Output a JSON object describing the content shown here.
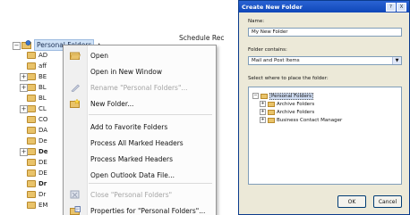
{
  "folder_pane": {
    "root_label": "Personal Folders",
    "truncated_header": "Schedule Recur...",
    "items": [
      {
        "label": "AD",
        "bold": false
      },
      {
        "label": "aff",
        "bold": false
      },
      {
        "label": "BE",
        "bold": false
      },
      {
        "label": "BL",
        "bold": false
      },
      {
        "label": "BL",
        "bold": false
      },
      {
        "label": "CL",
        "bold": false
      },
      {
        "label": "CO",
        "bold": false
      },
      {
        "label": "DA",
        "bold": false
      },
      {
        "label": "De",
        "bold": false
      },
      {
        "label": "De",
        "bold": true
      },
      {
        "label": "DE",
        "bold": false
      },
      {
        "label": "DE",
        "bold": false
      },
      {
        "label": "Dr",
        "bold": true
      },
      {
        "label": "Dr",
        "bold": false
      },
      {
        "label": "EM",
        "bold": false
      }
    ]
  },
  "context_menu": {
    "items": [
      {
        "label": "Open",
        "icon": "open-folder-icon",
        "disabled": false
      },
      {
        "label": "Open in New Window",
        "icon": "",
        "disabled": false
      },
      {
        "label": "Rename \"Personal Folders\"...",
        "icon": "rename-icon",
        "disabled": true
      },
      {
        "label": "New Folder...",
        "icon": "new-folder-icon",
        "disabled": false
      },
      {
        "label": "Add to Favorite Folders",
        "icon": "",
        "disabled": false
      },
      {
        "label": "Process All Marked Headers",
        "icon": "",
        "disabled": false
      },
      {
        "label": "Process Marked Headers",
        "icon": "",
        "disabled": false
      },
      {
        "label": "Open Outlook Data File...",
        "icon": "",
        "disabled": false
      },
      {
        "label": "Close \"Personal Folders\"",
        "icon": "close-data-file-icon",
        "disabled": true
      },
      {
        "label": "Properties for \"Personal Folders\"...",
        "icon": "properties-icon",
        "disabled": false
      }
    ]
  },
  "dialog": {
    "title": "Create New Folder",
    "help_button": "?",
    "close_button": "X",
    "name_label": "Name:",
    "name_value": "My New Folder",
    "contains_label": "Folder contains:",
    "contains_value": "Mail and Post Items",
    "place_label": "Select where to place the folder:",
    "tree": [
      {
        "label": "Personal Folders",
        "level": 0,
        "selected": true
      },
      {
        "label": "Archive Folders",
        "level": 1,
        "selected": false
      },
      {
        "label": "Archive Folders",
        "level": 1,
        "selected": false
      },
      {
        "label": "Business Contact Manager",
        "level": 1,
        "selected": false
      }
    ],
    "ok_label": "OK",
    "cancel_label": "Cancel"
  },
  "colors": {
    "titlebar": "#0f47b8",
    "dialog_bg": "#ece9d8",
    "folder_yellow": "#e9c36a",
    "selection": "#cfe2f7"
  }
}
